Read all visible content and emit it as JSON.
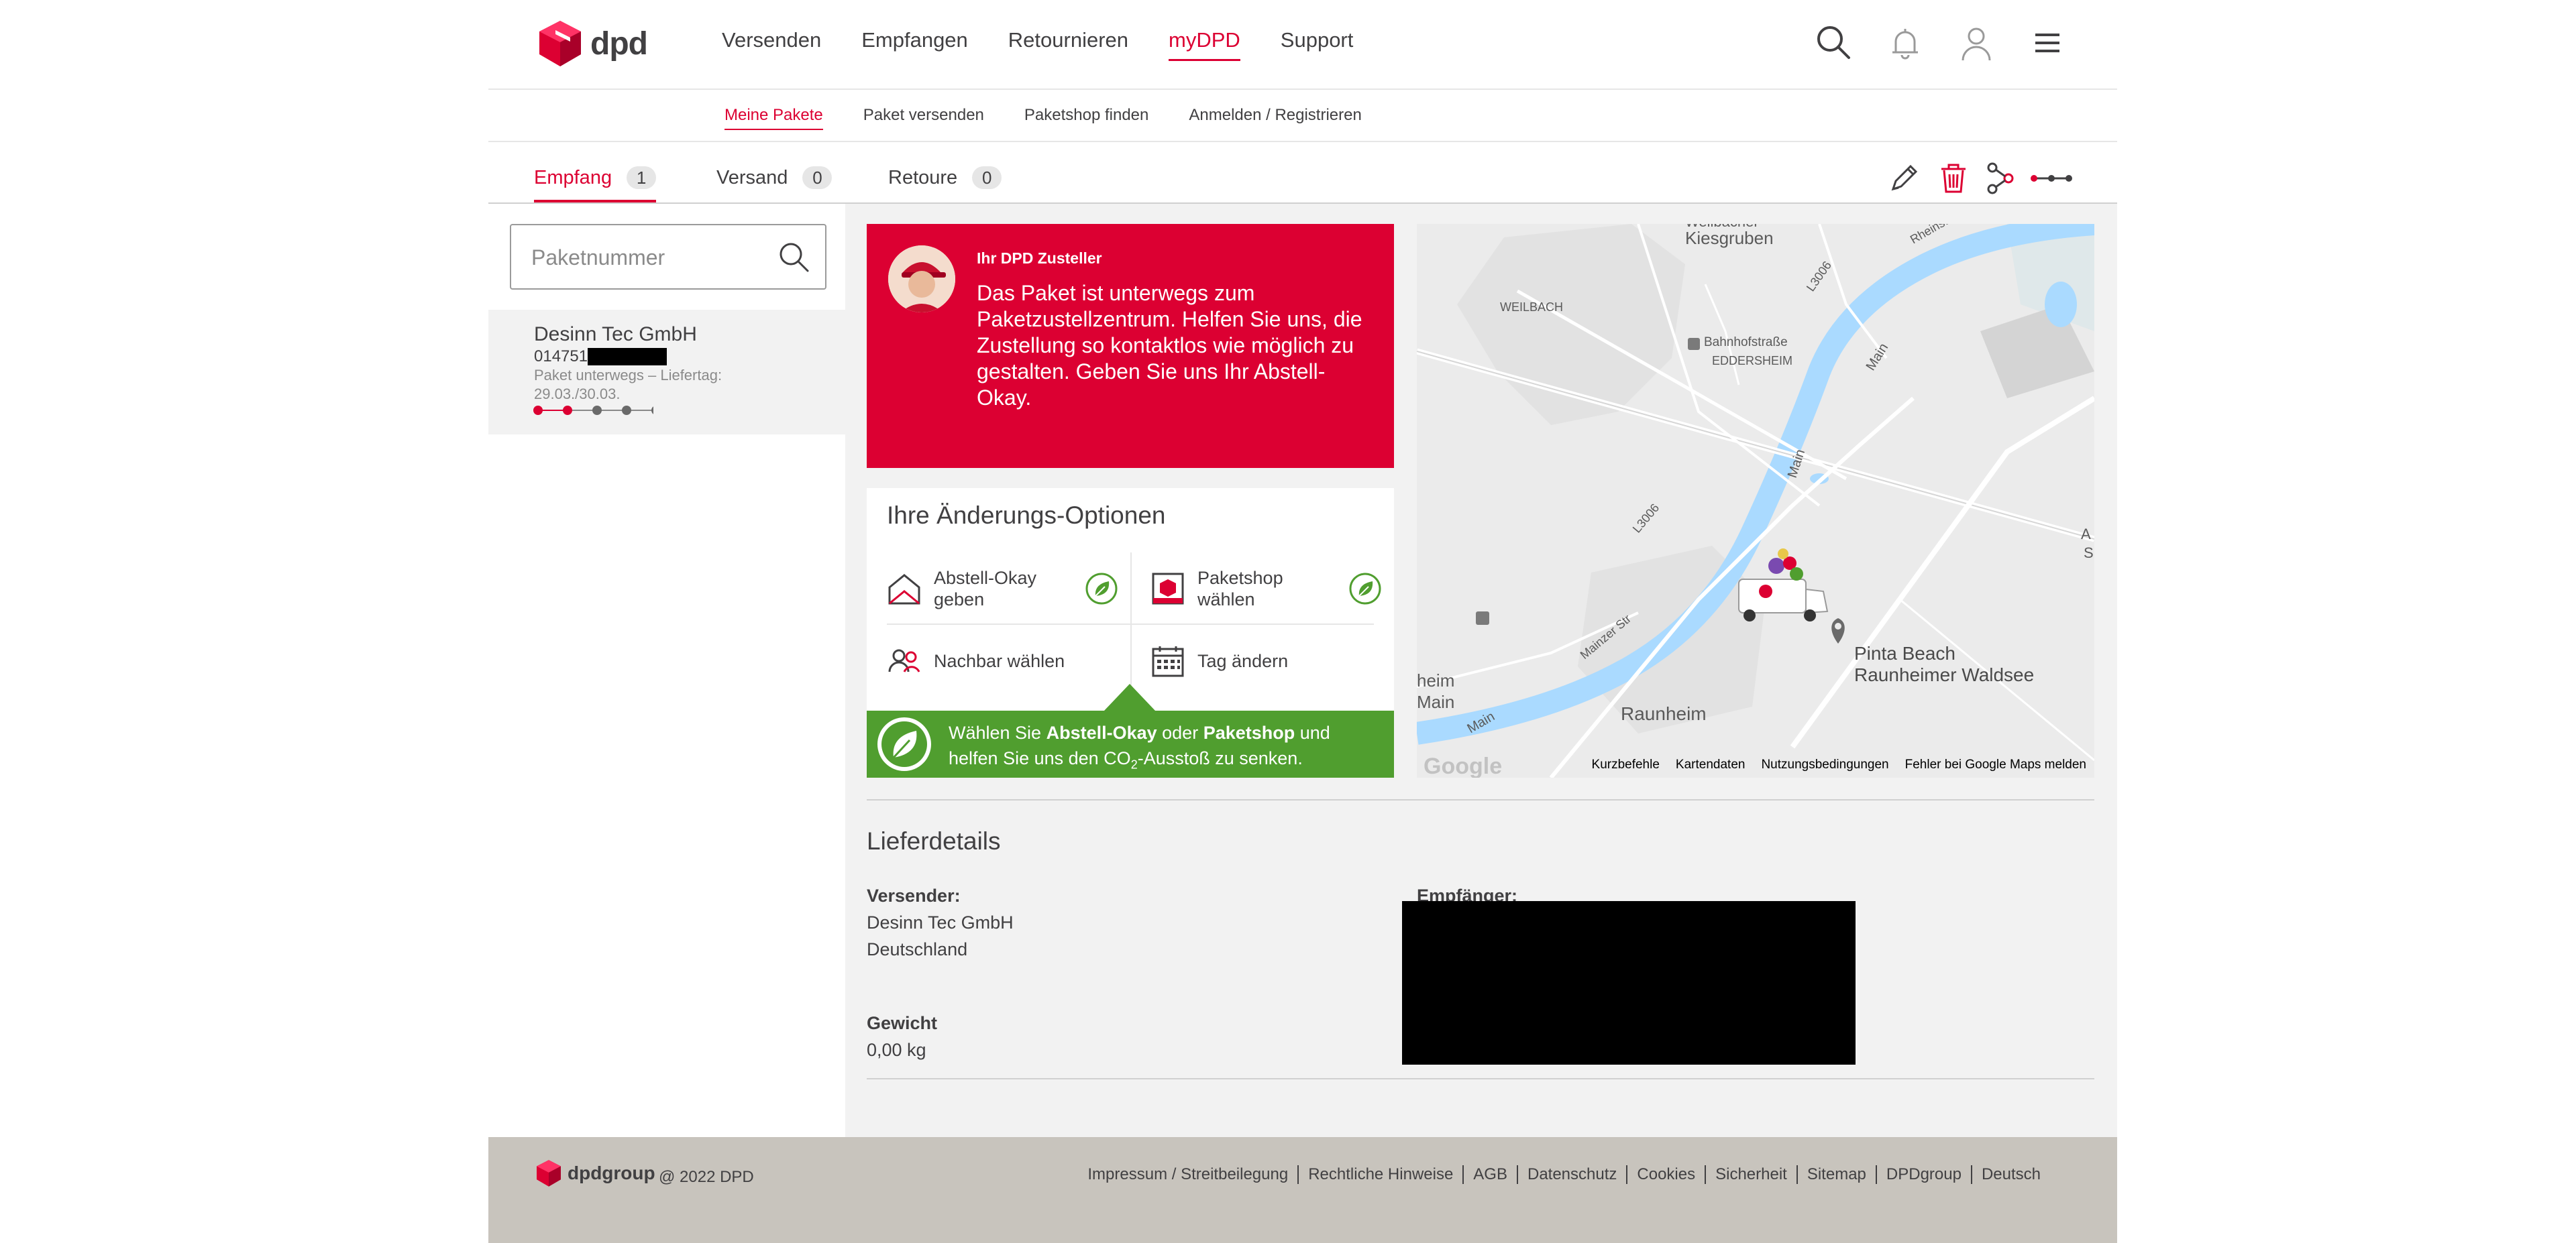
{
  "header": {
    "brand": "dpd",
    "nav": [
      "Versenden",
      "Empfangen",
      "Retournieren",
      "myDPD",
      "Support"
    ],
    "active_nav": "myDPD"
  },
  "subnav": {
    "items": [
      "Meine Pakete",
      "Paket versenden",
      "Paketshop finden",
      "Anmelden / Registrieren"
    ]
  },
  "tabs": [
    {
      "label": "Empfang",
      "count": "1"
    },
    {
      "label": "Versand",
      "count": "0"
    },
    {
      "label": "Retoure",
      "count": "0"
    }
  ],
  "search": {
    "placeholder": "Paketnummer"
  },
  "parcel": {
    "sender": "Desinn Tec GmbH",
    "number_prefix": "014751",
    "status": "Paket unterwegs – Liefertag: 29.03./30.03.",
    "progress_step": 2,
    "progress_total": 5
  },
  "deliverer": {
    "title": "Ihr DPD Zusteller",
    "message": "Das Paket ist unterwegs zum Paketzustellzentrum. Helfen Sie uns, die Zustellung so kontaktlos wie möglich zu gestalten. Geben Sie uns Ihr Abstell-Okay."
  },
  "options": {
    "title": "Ihre Änderungs-Optionen",
    "items": [
      {
        "label": "Abstell-Okay geben",
        "icon": "house-icon",
        "eco": true
      },
      {
        "label": "Paketshop wählen",
        "icon": "parcelshop-icon",
        "eco": true
      },
      {
        "label": "Nachbar wählen",
        "icon": "neighbours-icon",
        "eco": false
      },
      {
        "label": "Tag ändern",
        "icon": "calendar-icon",
        "eco": false
      }
    ],
    "eco_banner": {
      "part1": "Wählen Sie ",
      "bold1": "Abstell-Okay",
      "part2": " oder ",
      "bold2": "Paketshop",
      "part3": " und helfen Sie uns den CO",
      "sub": "2",
      "part4": "-Ausstoß zu senken."
    }
  },
  "map": {
    "labels": {
      "weilbacher": "Weilbacher",
      "kiesgruben": "Kiesgruben",
      "weilbach": "WEILBACH",
      "bahnhof": "Bahnhofstraße",
      "eddersheim": "EDDERSHEIM",
      "main1": "Main",
      "main2": "Main",
      "main3": "Main",
      "heim": "heim",
      "main4": "Main",
      "raunheim": "Raunheim",
      "l3006a": "L3006",
      "l3006b": "L3006",
      "mainzer": "Mainzer Str",
      "rheinstr": "Rheinstr.",
      "poi_line1": "Pinta Beach",
      "poi_line2": "Raunheimer Waldsee",
      "edge_a": "A",
      "edge_s": "S",
      "google": "Google"
    },
    "footer": [
      "Kurzbefehle",
      "Kartendaten",
      "Nutzungsbedingungen",
      "Fehler bei Google Maps melden"
    ]
  },
  "details": {
    "title": "Lieferdetails",
    "sender_label": "Versender:",
    "sender_name": "Desinn Tec GmbH",
    "sender_country": "Deutschland",
    "recipient_label": "Empfänger:",
    "weight_label": "Gewicht",
    "weight_value": "0,00 kg"
  },
  "footer": {
    "brand": "dpdgroup",
    "copyright": "@ 2022 DPD",
    "links": [
      "Impressum / Streitbeilegung",
      "Rechtliche Hinweise",
      "AGB",
      "Datenschutz",
      "Cookies",
      "Sicherheit",
      "Sitemap",
      "DPDgroup",
      "Deutsch"
    ]
  },
  "colors": {
    "brand_red": "#dc0032",
    "eco_green": "#509e2f",
    "text": "#414042"
  }
}
